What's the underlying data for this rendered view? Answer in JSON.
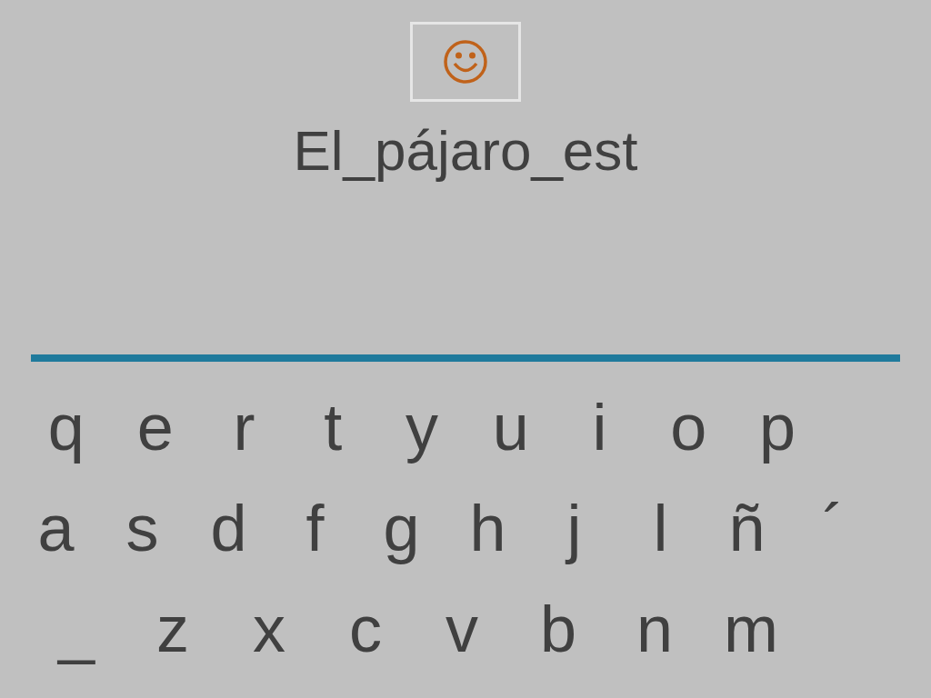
{
  "answer": "El_pájaro_est",
  "keyboard": [
    [
      "q",
      "e",
      "r",
      "t",
      "y",
      "u",
      "i",
      "o",
      "p"
    ],
    [
      "a",
      "s",
      "d",
      "f",
      "g",
      "h",
      "j",
      "l",
      "ñ",
      "´"
    ],
    [
      "_",
      "z",
      "x",
      "c",
      "v",
      "b",
      "n",
      "m"
    ]
  ]
}
